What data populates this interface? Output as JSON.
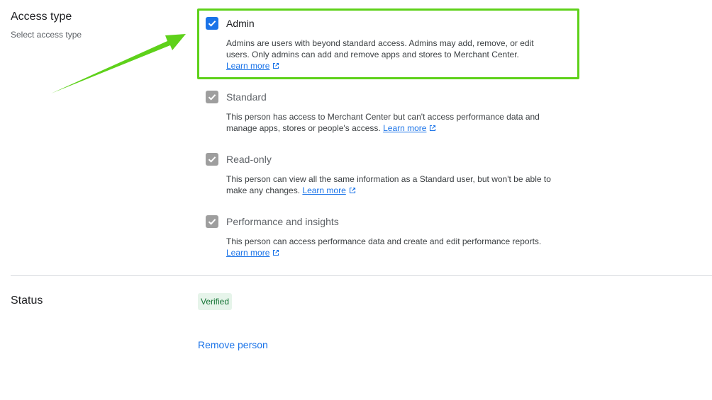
{
  "access": {
    "title": "Access type",
    "subtitle": "Select access type",
    "options": [
      {
        "label": "Admin",
        "description": "Admins are users with beyond standard access. Admins may add, remove, or edit users. Only admins can add and remove apps and stores to Merchant Center.",
        "link": "Learn more",
        "checked": true
      },
      {
        "label": "Standard",
        "description": "This person has access to Merchant Center but can't access performance data and manage apps, stores or people's access.",
        "link": "Learn more",
        "checked": true,
        "disabled": true
      },
      {
        "label": "Read-only",
        "description": "This person can view all the same information as a Standard user, but won't be able to make any changes.",
        "link": "Learn more",
        "checked": true,
        "disabled": true
      },
      {
        "label": "Performance and insights",
        "description": "This person can access performance data and create and edit performance reports.",
        "link": "Learn more",
        "checked": true,
        "disabled": true
      }
    ]
  },
  "status": {
    "title": "Status",
    "badge": "Verified"
  },
  "actions": {
    "remove_label": "Remove person"
  },
  "colors": {
    "accent": "#1a73e8",
    "highlight": "#5ed11a",
    "disabled_check": "#9e9e9e",
    "verified_bg": "#e6f4ea"
  },
  "icons": [
    "checkmark-icon",
    "external-link-icon",
    "annotation-arrow"
  ]
}
